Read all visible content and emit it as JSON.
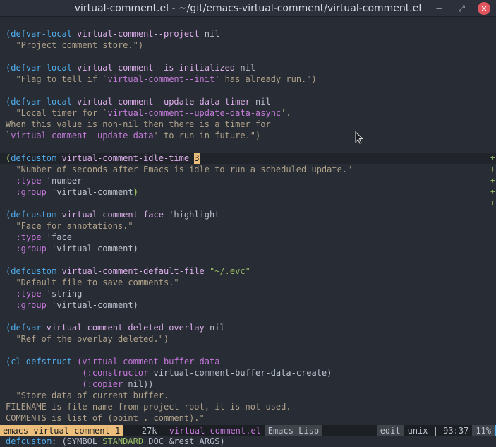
{
  "window": {
    "title": "virtual-comment.el - ~/git/emacs-virtual-comment/virtual-comment.el",
    "minimize_glyph": "−",
    "maximize_glyph": "⤢",
    "close_glyph": "✕"
  },
  "code": {
    "l1": [
      "(defvar-local",
      " virtual-comment--project",
      " nil"
    ],
    "l2": "  \"Project comment store.\")",
    "l4": [
      "(defvar-local",
      " virtual-comment--is-initialized",
      " nil"
    ],
    "l5a": "  \"Flag to tell if `",
    "l5b": "virtual-comment--init",
    "l5c": "' has already run.\")",
    "l7": [
      "(defvar-local",
      " virtual-comment--update-data-timer",
      " nil"
    ],
    "l8a": "  \"Local timer for `",
    "l8b": "virtual-comment--update-data-async",
    "l8c": "'.",
    "l9": "When this value is non-nil then there is a timer for",
    "l10a": "`",
    "l10b": "virtual-comment--update-data",
    "l10c": "' to run in future.\")",
    "l12a": "(",
    "l12b": "defcustom",
    "l12c": " virtual-comment-idle-time",
    "l12d": " ",
    "l12e": "3",
    "l13": "  \"Number of seconds after Emacs is idle to run a scheduled update.\"",
    "l14a": "  :type",
    "l14b": " 'number",
    "l15a": "  :group",
    "l15b": " 'virtual-comment",
    "l15c": ")",
    "l17": [
      "(defcustom",
      " virtual-comment-face",
      " 'highlight"
    ],
    "l18": "  \"Face for annotations.\"",
    "l19a": "  :type",
    "l19b": " 'face",
    "l20a": "  :group",
    "l20b": " 'virtual-comment)",
    "l22": [
      "(defcustom",
      " virtual-comment-default-file",
      " \"~/.evc\""
    ],
    "l23": "  \"Default file to save comments.\"",
    "l24a": "  :type",
    "l24b": " 'string",
    "l25a": "  :group",
    "l25b": " 'virtual-comment)",
    "l27": [
      "(defvar",
      " virtual-comment-deleted-overlay",
      " nil"
    ],
    "l28": "  \"Ref of the overlay deleted.\")",
    "l30a": "(cl-defstruct",
    "l30b": " (virtual-comment-buffer-data",
    "l31a": "               (:constructor",
    "l31b": " virtual-comment-buffer-data-create)",
    "l32a": "               (:copier",
    "l32b": " nil))",
    "l33": "  \"Store data of current buffer.",
    "l34": "FILENAME is file name from project root, it is not used.",
    "l35": "COMMENTS is list of (point . comment).\""
  },
  "gutter_marks": [
    "+",
    "+",
    "+",
    "+",
    "+"
  ],
  "modeline": {
    "buffer": "emacs-virtual-comment 1",
    "size": " - 27k ",
    "file": "virtual-comment.el",
    "mode": "Emacs-Lisp",
    "state": "edit",
    "eol": "unix | 93:37",
    "percent": "11%"
  },
  "echo": {
    "fn": "defcustom",
    "colon": ": (SYMBOL ",
    "std": "STANDARD",
    "rest": " DOC &rest ARGS)"
  },
  "colors": {
    "background": "#282c34",
    "keyword": "#51afef",
    "variable": "#dcaeea",
    "string": "#98be65",
    "cursor": "#ecbe7b"
  }
}
